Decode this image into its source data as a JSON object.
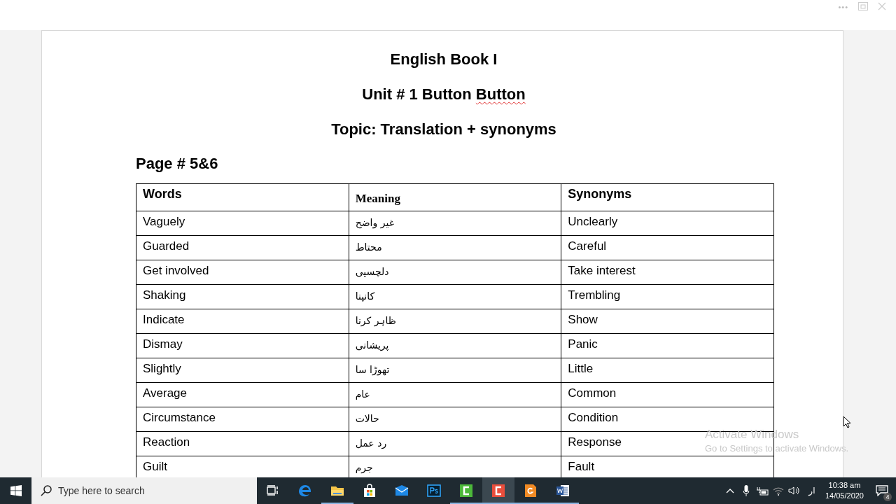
{
  "window_controls": [
    "•••"
  ],
  "document": {
    "title": "English Book I",
    "unit_heading": [
      {
        "text": "Unit # 1 Button ",
        "misspelled": false
      },
      {
        "text": "Button",
        "misspelled": true
      }
    ],
    "topic": "Topic: Translation + synonyms",
    "page_label": "Page # 5&6",
    "table": {
      "columns": [
        "Words",
        "Meaning",
        "Synonyms"
      ],
      "rows": [
        [
          "Vaguely",
          "غیر واضح",
          "Unclearly"
        ],
        [
          "Guarded",
          "محتاط",
          "Careful"
        ],
        [
          "Get involved",
          "دلچسپی",
          "Take interest"
        ],
        [
          "Shaking",
          "کانپنا",
          "Trembling"
        ],
        [
          "Indicate",
          "ظاہر کرنا",
          "Show"
        ],
        [
          "Dismay",
          "پریشانی",
          "Panic"
        ],
        [
          "Slightly",
          "تھوڑا سا",
          "Little"
        ],
        [
          "Average",
          "عام",
          "Common"
        ],
        [
          "Circumstance",
          "حالات",
          "Condition"
        ],
        [
          "Reaction",
          "رد عمل",
          "Response"
        ],
        [
          "Guilt",
          "جرم",
          "Fault"
        ]
      ]
    }
  },
  "activation_notice": {
    "title": "Activate Windows",
    "text": "Go to Settings to activate Windows."
  },
  "taskbar": {
    "search": {
      "placeholder": "Type here to search"
    },
    "apps": [
      {
        "kind": "edge",
        "running": false,
        "active": false
      },
      {
        "kind": "explorer",
        "running": true,
        "active": false
      },
      {
        "kind": "store",
        "running": false,
        "active": false
      },
      {
        "kind": "mail",
        "running": false,
        "active": false
      },
      {
        "kind": "photoshop",
        "running": false,
        "active": false
      },
      {
        "kind": "camtasia-green",
        "running": true,
        "active": false
      },
      {
        "kind": "camtasia-red",
        "running": true,
        "active": true
      },
      {
        "kind": "office-orange",
        "running": true,
        "active": false
      },
      {
        "kind": "word",
        "running": true,
        "active": false
      }
    ],
    "language": "ار",
    "time": "10:38 am",
    "date": "14/05/2020",
    "notifications": "4"
  }
}
